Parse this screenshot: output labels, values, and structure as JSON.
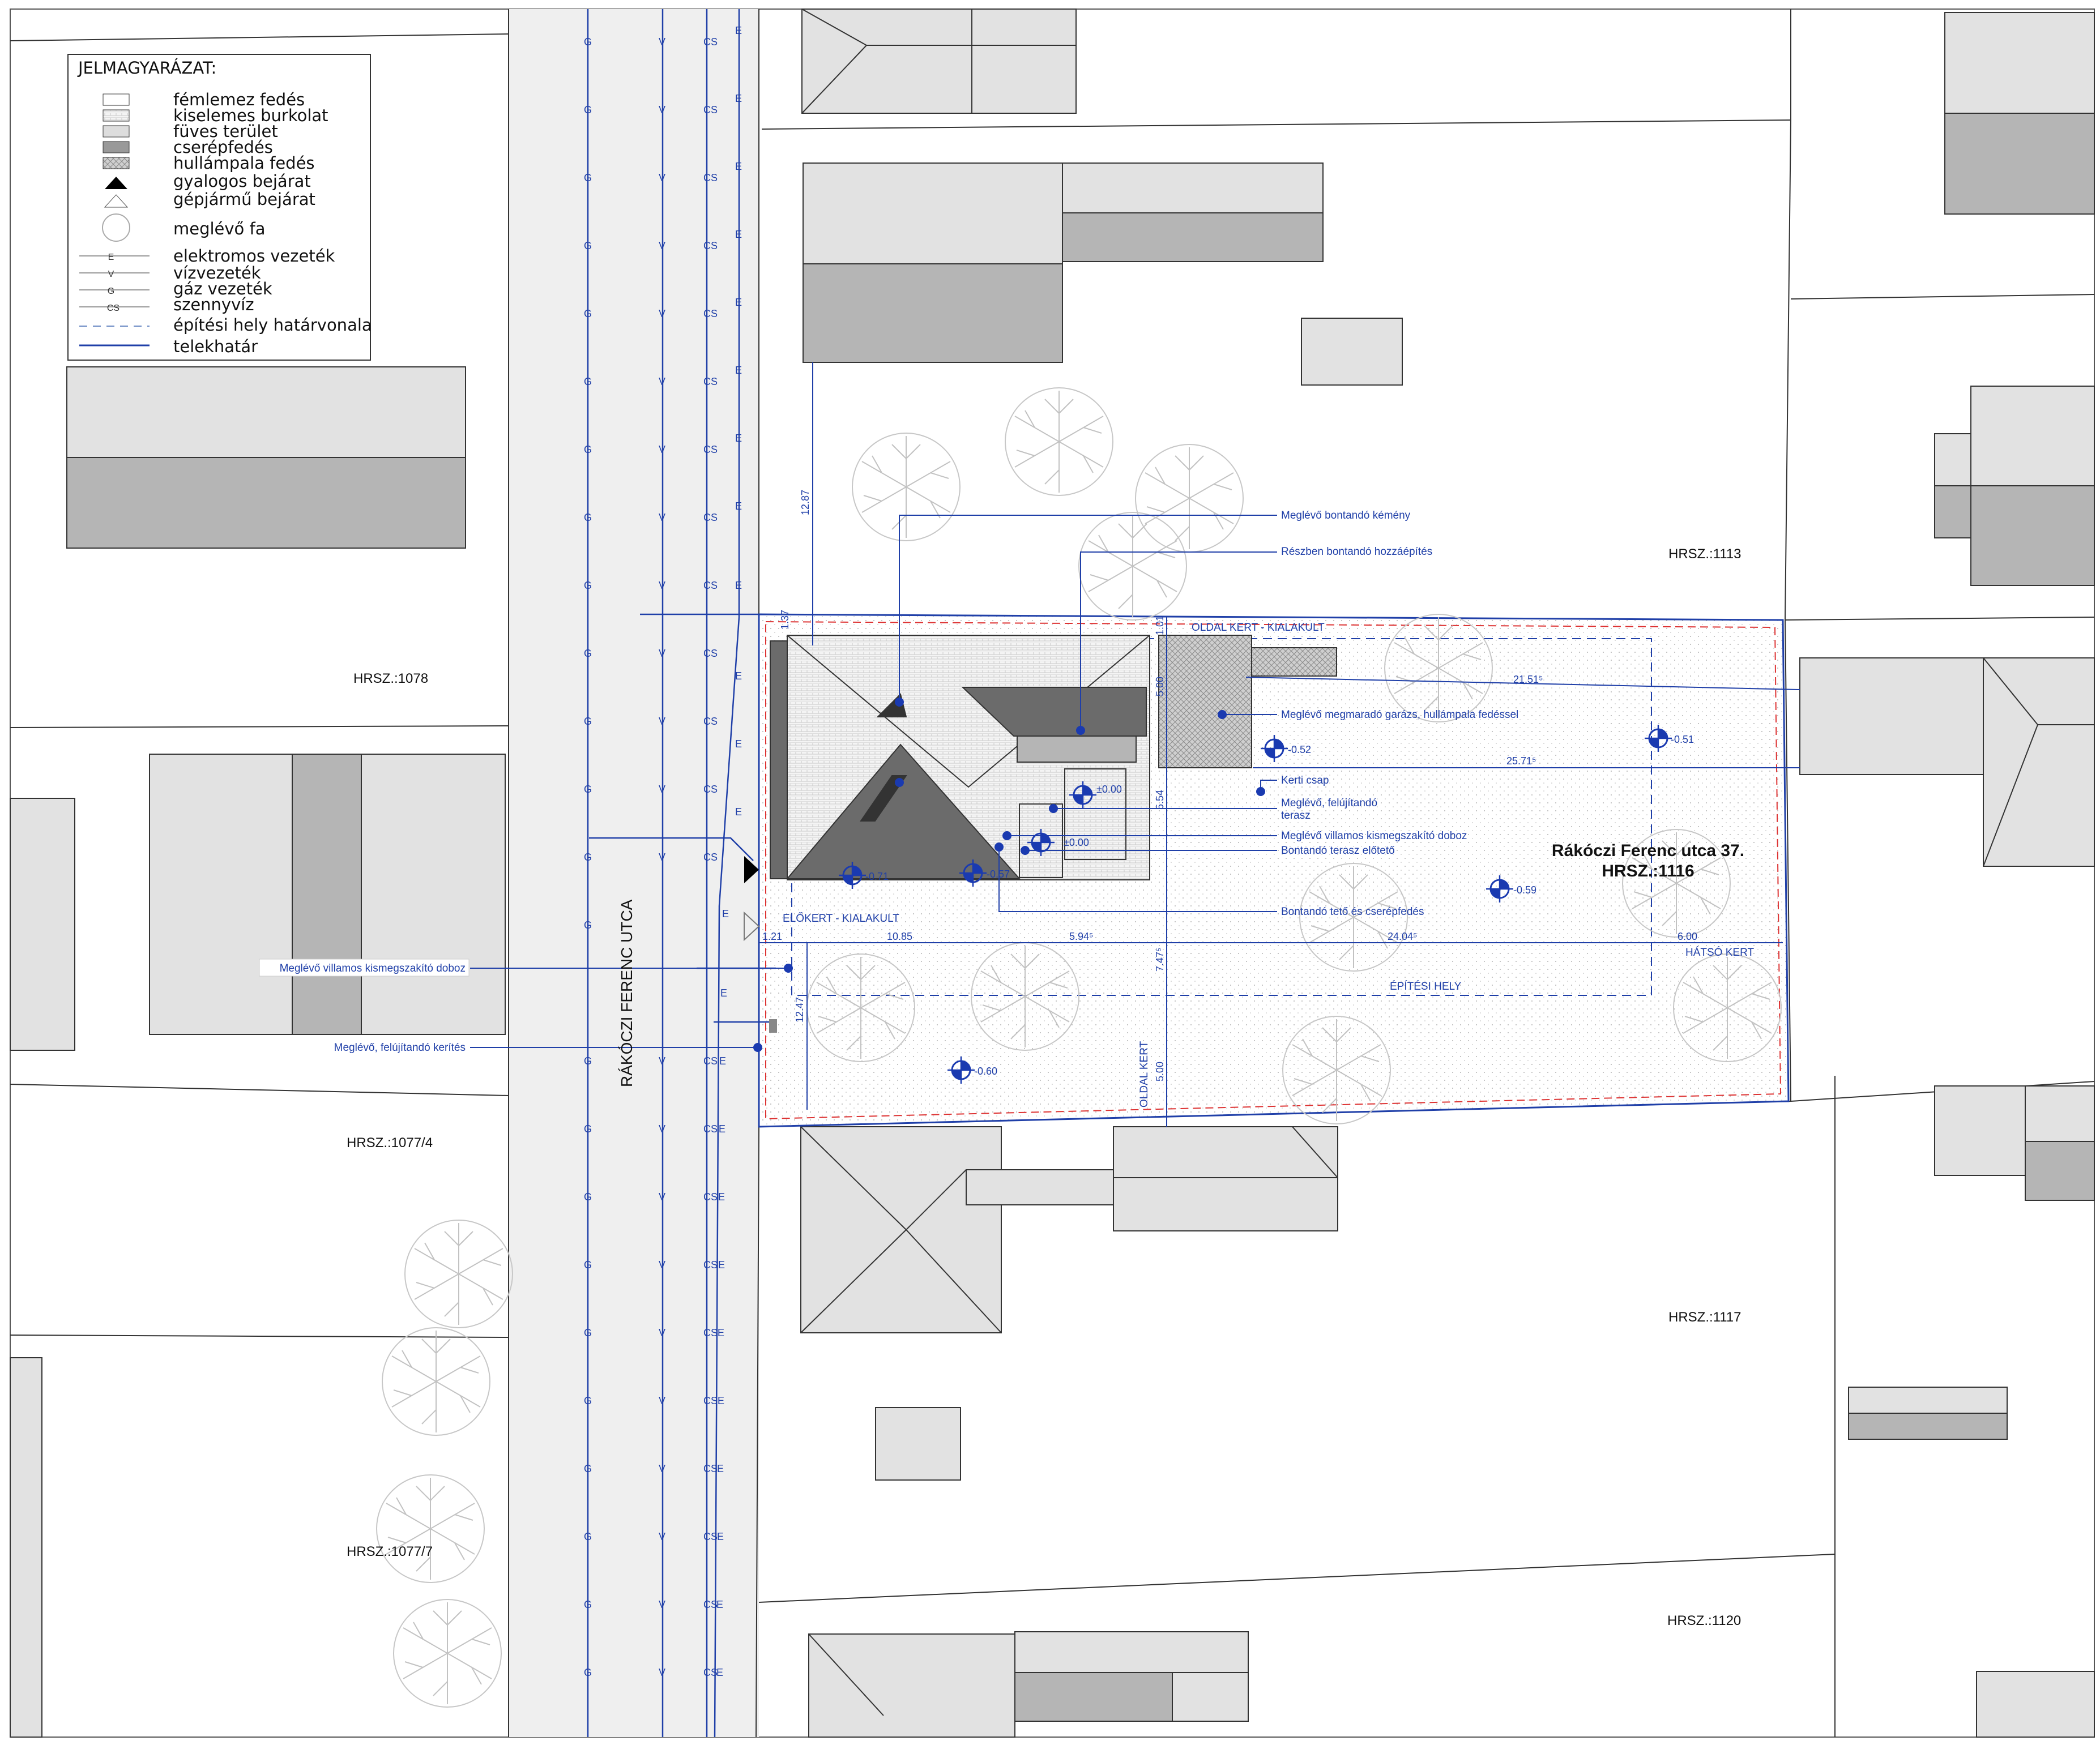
{
  "legend": {
    "title": "JELMAGYARÁZAT:",
    "items": [
      {
        "label": "fémlemez fedés",
        "icon": "metal-roof-hatch-icon"
      },
      {
        "label": "kiselemes burkolat",
        "icon": "paving-hatch-icon"
      },
      {
        "label": "füves terület",
        "icon": "grass-hatch-icon"
      },
      {
        "label": "cserépfedés",
        "icon": "tile-roof-hatch-icon"
      },
      {
        "label": "hullámpala fedés",
        "icon": "corrugated-slate-hatch-icon"
      },
      {
        "label": "gyalogos bejárat",
        "icon": "pedestrian-entrance-icon"
      },
      {
        "label": "gépjármű bejárat",
        "icon": "vehicle-entrance-icon"
      },
      {
        "label": "meglévő fa",
        "icon": "tree-icon"
      },
      {
        "label": "elektromos vezeték",
        "line_mark": "E"
      },
      {
        "label": "vízvezeték",
        "line_mark": "V"
      },
      {
        "label": "gáz vezeték",
        "line_mark": "G"
      },
      {
        "label": "szennyvíz",
        "line_mark": "CS"
      },
      {
        "label": "építési hely határvonala",
        "line_mark": ""
      },
      {
        "label": "telekhatár",
        "line_mark": ""
      }
    ]
  },
  "parcels": {
    "p1078": "HRSZ.:1078",
    "p1077_4": "HRSZ.:1077/4",
    "p1077_7": "HRSZ.:1077/7",
    "p1113": "HRSZ.:1113",
    "p1117": "HRSZ.:1117",
    "p1120": "HRSZ.:1120"
  },
  "street_name": "RÁKÓCZI FERENC UTCA",
  "main_plot": {
    "address": "Rákóczi Ferenc utca 37.",
    "hrsz": "HRSZ.:1116"
  },
  "zones": {
    "side_garden": "OLDAL KERT - KIALAKULT",
    "front_garden": "ELŐKERT - KIALAKULT",
    "rear_garden": "HÁTSÓ KERT",
    "building_area": "ÉPÍTÉSI HELY",
    "side_garden_vertical": "OLDAL KERT"
  },
  "annotations": {
    "chimney": "Meglévő bontandó kémény",
    "partial_extension": "Részben bontandó hozzáépítés",
    "garage": "Meglévő megmaradó garázs, hullámpala fedéssel",
    "garden_tap": "Kerti csap",
    "terrace": "Meglévő, felújítandó",
    "terrace_2": "terasz",
    "electric_box": "Meglévő villamos kismegszakító doboz",
    "terrace_canopy": "Bontandó terasz előtető",
    "roof_tiles": "Bontandó tető és cserépfedés",
    "electric_box_street": "Meglévő villamos kismegszakító doboz",
    "fence": "Meglévő, felújítandó kerítés"
  },
  "levels": {
    "l1": "-0.52",
    "l2": "-0.51",
    "l3": "±0.00",
    "l4": "±0.00",
    "l5": "-0.71",
    "l6": "-0.57",
    "l7": "-0.59",
    "l8": "-0.60"
  },
  "dimensions": {
    "d_12_87": "12.87",
    "d_1_37": "1.37",
    "d_1_01": "1.01",
    "d_5_00_a": "5.00",
    "d_21_51": "21.51⁵",
    "d_25_71": "25.71⁵",
    "d_5_54": "5.54",
    "d_1_21": "1.21",
    "d_10_85": "10.85",
    "d_5_94": "5.94⁵",
    "d_24_04": "24.04⁵",
    "d_6_00": "6.00",
    "d_7_47": "7.47⁵",
    "d_12_47": "12.47",
    "d_5_00_b": "5.00"
  },
  "colors": {
    "line_blue": "#1f3fa8",
    "building_light": "#e2e2e2",
    "building_dark": "#b5b5b5",
    "roof_dark": "#6b6b6b",
    "street": "#efefef",
    "marker_blue": "#1a3ab0"
  }
}
